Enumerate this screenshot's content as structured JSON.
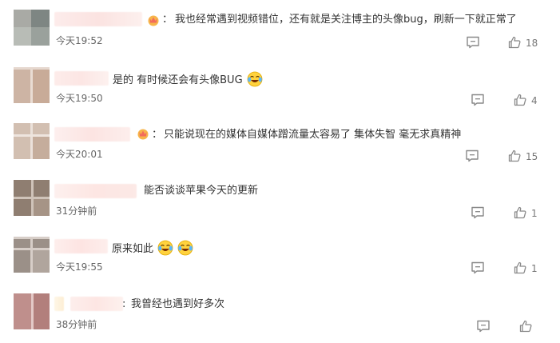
{
  "colors": {
    "text": "#333333",
    "time": "#666666",
    "icon": "#888888"
  },
  "comments": [
    {
      "text": "我也经常遇到视频错位，还有就是关注博主的头像bug，刷新一下就正常了",
      "time": "今天19:52",
      "likes": "18",
      "badge": "crown-badge-icon",
      "emojis": 0
    },
    {
      "text": "是的 有时候还会有头像BUG",
      "time": "今天19:50",
      "likes": "4",
      "badge": null,
      "emojis": 1
    },
    {
      "text": "只能说现在的媒体自媒体蹭流量太容易了 集体失智 毫无求真精神",
      "time": "今天20:01",
      "likes": "15",
      "badge": "crown-badge-icon",
      "emojis": 0
    },
    {
      "text": "能否谈谈苹果今天的更新",
      "time": "31分钟前",
      "likes": "1",
      "badge": null,
      "emojis": 0
    },
    {
      "text": "原来如此",
      "time": "今天19:55",
      "likes": "1",
      "badge": null,
      "emojis": 2
    },
    {
      "text": "我曾经也遇到好多次",
      "time": "38分钟前",
      "likes": "",
      "badge": null,
      "emojis": 0
    }
  ],
  "emoji_name": "laughing-tears-emoji-icon"
}
